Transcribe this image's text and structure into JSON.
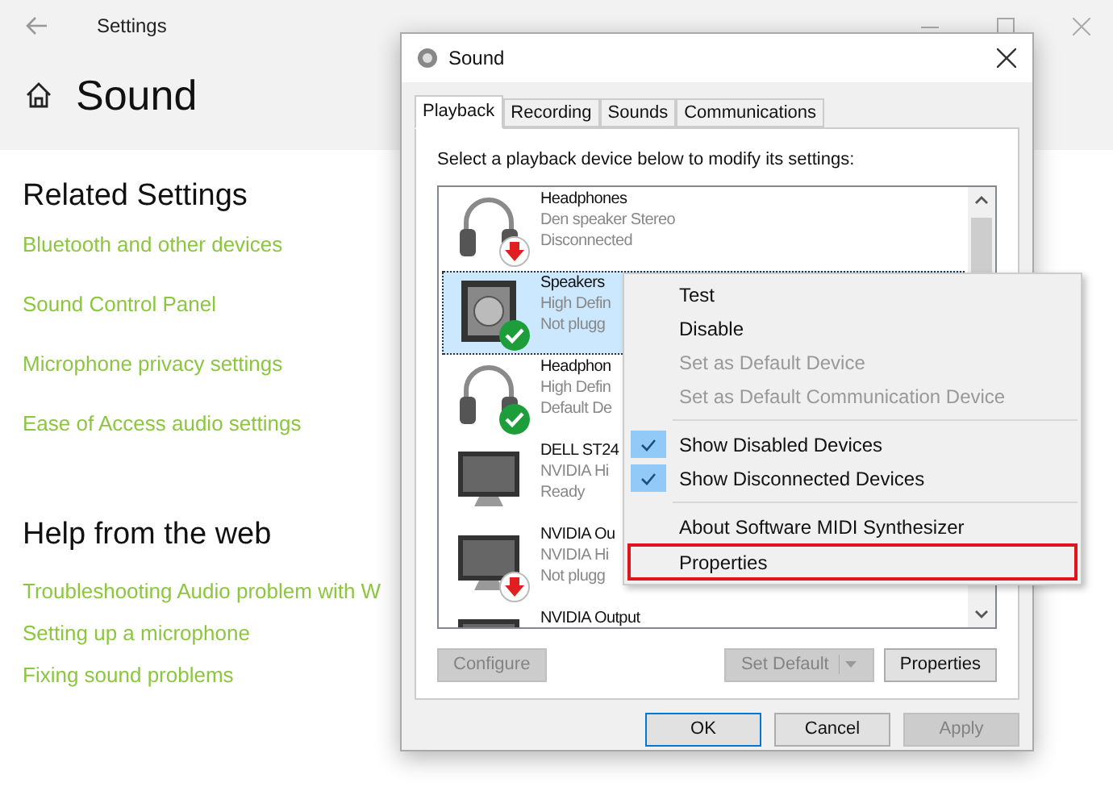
{
  "settings_window": {
    "title": "Settings",
    "page_title": "Sound",
    "sections": [
      {
        "heading": "Related Settings",
        "links": [
          "Bluetooth and other devices",
          "Sound Control Panel",
          "Microphone privacy settings",
          "Ease of Access audio settings"
        ]
      },
      {
        "heading": "Help from the web",
        "links": [
          "Troubleshooting Audio problem with W",
          "Setting up a microphone",
          "Fixing sound problems"
        ]
      }
    ]
  },
  "dialog": {
    "title": "Sound",
    "tabs": [
      {
        "label": "Playback",
        "selected": true
      },
      {
        "label": "Recording",
        "selected": false
      },
      {
        "label": "Sounds",
        "selected": false
      },
      {
        "label": "Communications",
        "selected": false
      }
    ],
    "instruction": "Select a playback device below to modify its settings:",
    "devices": [
      {
        "kind": "headphones",
        "disconnected": true,
        "default": false,
        "name": "Headphones",
        "description": "Den speaker Stereo",
        "status": "Disconnected",
        "selected": false
      },
      {
        "kind": "speaker",
        "disconnected": false,
        "default": true,
        "name": "Speakers",
        "description": "High Defin",
        "status": "Not plugg",
        "selected": true
      },
      {
        "kind": "headphones",
        "disconnected": false,
        "default": true,
        "name": "Headphon",
        "description": "High Defin",
        "status": "Default De",
        "selected": false
      },
      {
        "kind": "monitor",
        "disconnected": false,
        "default": false,
        "name": "DELL ST24",
        "description": "NVIDIA Hi",
        "status": "Ready",
        "selected": false
      },
      {
        "kind": "monitor",
        "disconnected": true,
        "default": false,
        "name": "NVIDIA Ou",
        "description": "NVIDIA Hi",
        "status": "Not plugg",
        "selected": false
      },
      {
        "kind": "monitor",
        "disconnected": false,
        "default": false,
        "name": "NVIDIA Output",
        "selected": false
      }
    ],
    "list_buttons": [
      {
        "label": "Configure",
        "disabled": true,
        "split": false
      },
      {
        "label": "Set Default",
        "disabled": true,
        "split": true
      },
      {
        "label": "Properties",
        "disabled": false,
        "split": false
      }
    ],
    "footer_buttons": [
      {
        "label": "OK",
        "disabled": false,
        "default": true
      },
      {
        "label": "Cancel",
        "disabled": false,
        "default": false
      },
      {
        "label": "Apply",
        "disabled": true,
        "default": false
      }
    ]
  },
  "context_menu": {
    "items": [
      {
        "kind": "item",
        "label": "Test",
        "disabled": false,
        "checked": false,
        "selected": false
      },
      {
        "kind": "item",
        "label": "Disable",
        "disabled": false,
        "checked": false,
        "selected": false
      },
      {
        "kind": "item",
        "label": "Set as Default Device",
        "disabled": true,
        "checked": false,
        "selected": false
      },
      {
        "kind": "item",
        "label": "Set as Default Communication Device",
        "disabled": true,
        "checked": false,
        "selected": false
      },
      {
        "kind": "separator"
      },
      {
        "kind": "item",
        "label": "Show Disabled Devices",
        "disabled": false,
        "checked": true,
        "selected": false
      },
      {
        "kind": "item",
        "label": "Show Disconnected Devices",
        "disabled": false,
        "checked": true,
        "selected": false
      },
      {
        "kind": "separator"
      },
      {
        "kind": "item",
        "label": "About Software MIDI Synthesizer",
        "disabled": false,
        "checked": false,
        "selected": false
      },
      {
        "kind": "item",
        "label": "Properties",
        "disabled": false,
        "checked": false,
        "selected": true
      }
    ]
  }
}
